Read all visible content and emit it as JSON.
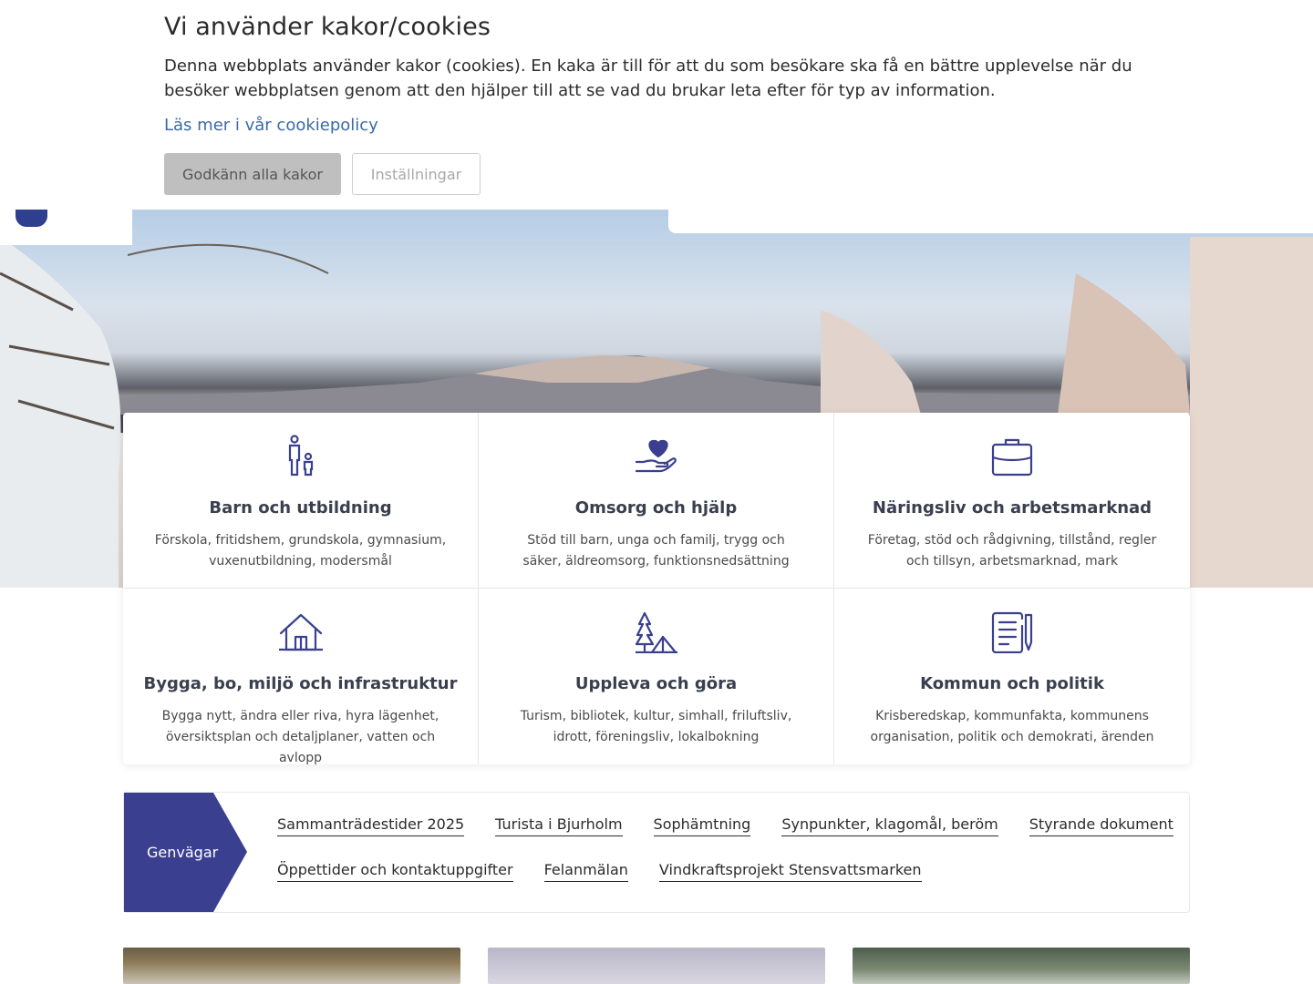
{
  "cookie_banner": {
    "title": "Vi använder kakor/cookies",
    "text": "Denna webbplats använder kakor (cookies). En kaka är till för att du som besökare ska få en bättre upplevelse när du besöker webbplatsen genom att den hjälper till att se vad du brukar leta efter för typ av information.",
    "policy_link": "Läs mer i vår cookiepolicy",
    "accept_button": "Godkänn alla kakor",
    "settings_button": "Inställningar"
  },
  "categories": [
    {
      "title": "Barn och utbildning",
      "description": "Förskola, fritidshem, grundskola, gymnasium, vuxenutbildning, modersmål",
      "icon": "family-icon"
    },
    {
      "title": "Omsorg och hjälp",
      "description": "Stöd till barn, unga och familj, trygg och säker, äldreomsorg, funktionsnedsättning",
      "icon": "heart-hand-icon"
    },
    {
      "title": "Näringsliv och arbetsmarknad",
      "description": "Företag, stöd och rådgivning, tillstånd, regler och tillsyn, arbetsmarknad, mark",
      "icon": "briefcase-icon"
    },
    {
      "title": "Bygga, bo, miljö och infrastruktur",
      "description": "Bygga nytt, ändra eller riva, hyra lägenhet, översiktsplan och detaljplaner, vatten och avlopp",
      "icon": "house-icon"
    },
    {
      "title": "Uppleva och göra",
      "description": "Turism, bibliotek, kultur, simhall, friluftsliv, idrott, föreningsliv, lokalbokning",
      "icon": "tree-tent-icon"
    },
    {
      "title": "Kommun och politik",
      "description": "Krisberedskap, kommunfakta, kommunens organisation, politik och demokrati, ärenden",
      "icon": "document-pen-icon"
    }
  ],
  "shortcuts": {
    "label": "Genvägar",
    "links": [
      "Sammanträdestider 2025",
      "Turista i Bjurholm",
      "Sophämtning",
      "Synpunkter, klagomål, beröm",
      "Styrande dokument",
      "Öppettider och kontaktuppgifter",
      "Felanmälan",
      "Vindkraftsprojekt Stensvattsmarken"
    ]
  },
  "colors": {
    "accent": "#3a3f8f",
    "link": "#3a6aa6",
    "accept_bg": "#bfbfbf"
  }
}
